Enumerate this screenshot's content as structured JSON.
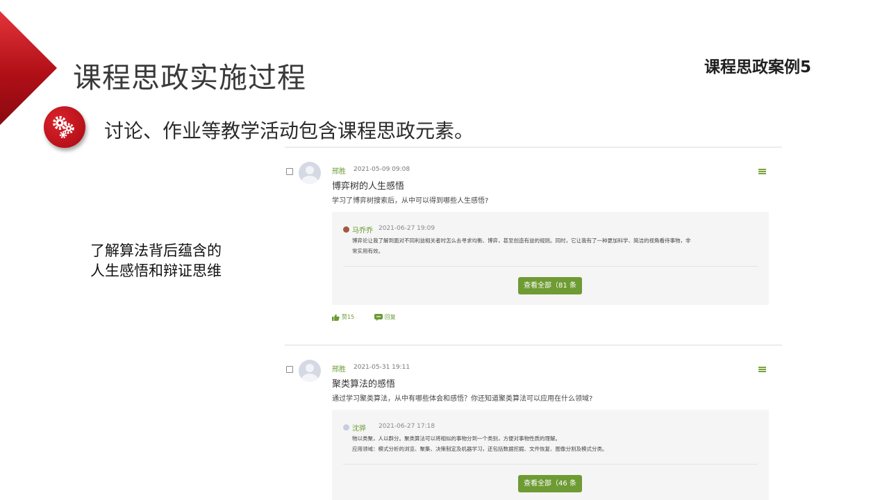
{
  "slide": {
    "title": "课程思政实施过程",
    "case_label": "课程思政案例5",
    "subtitle": "讨论、作业等教学活动包含课程思政元素。",
    "side_note": [
      "了解算法背后蕴含的",
      "人生感悟和辩证思维"
    ],
    "accent_color": "#c0121b"
  },
  "posts": [
    {
      "author": "邢胜",
      "time": "2021-05-09 09:08",
      "title": "博弈树的人生感悟",
      "description": "学习了博弈树搜索后，从中可以得到哪些人生感悟?",
      "reply": {
        "author": "马乔乔",
        "time": "2021-06-27 19:09",
        "lines": [
          "博弈论让我了解到面对不同利益相关者时怎么去寻求均衡、博弈，甚至创造有益的规则。同时，它让我有了一种更加科学、简洁的视角看待事物，非",
          "常实用有效。"
        ]
      },
      "view_all_label": "查看全部（81 条",
      "like_label": "赞15",
      "reply_label": "回复"
    },
    {
      "author": "邢胜",
      "time": "2021-05-31 19:11",
      "title": "聚类算法的感悟",
      "description": "通过学习聚类算法，从中有哪些体会和感悟？你还知道聚类算法可以应用在什么领域?",
      "reply": {
        "author": "沈骅",
        "time": "2021-06-27 17:18",
        "lines": [
          "物以类聚，人以群分。聚类算法可以将相似的事物分到一个类别，方便对事物性质的理解。",
          "应用领域：模式分析的浏览、聚集、决策制定及机器学习，还包括数据挖掘、文件恢复、图像分割及模式分类。"
        ]
      },
      "view_all_label": "查看全部（46 条"
    }
  ]
}
